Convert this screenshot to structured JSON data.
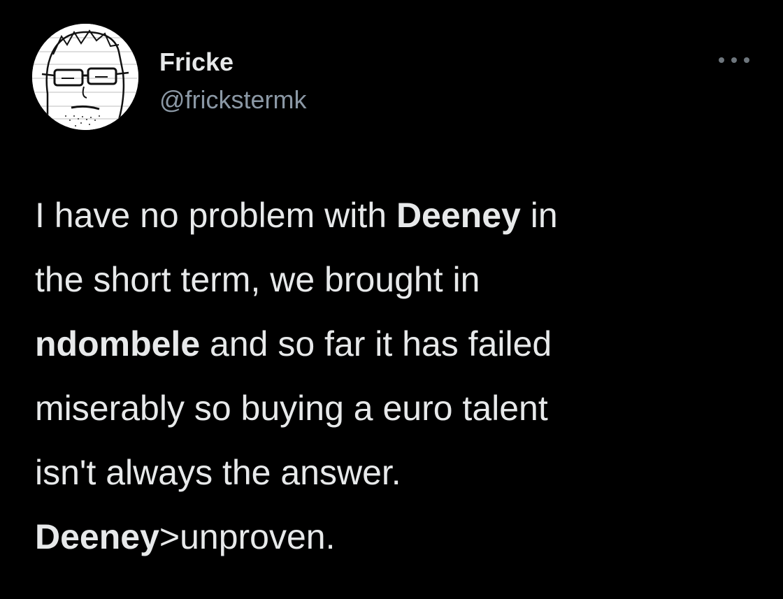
{
  "author": {
    "display_name": "Fricke",
    "handle": "@frickstermk",
    "avatar_icon": "cartoon-face-avatar"
  },
  "more_icon": "more-options-icon",
  "tweet": {
    "lines": [
      [
        {
          "text": "I have no problem with ",
          "bold": false
        },
        {
          "text": "Deeney",
          "bold": true
        },
        {
          "text": " in",
          "bold": false
        }
      ],
      [
        {
          "text": "the short term, we brought in",
          "bold": false
        }
      ],
      [
        {
          "text": "ndombele",
          "bold": true
        },
        {
          "text": " and so far it has failed",
          "bold": false
        }
      ],
      [
        {
          "text": "miserably so buying a euro talent",
          "bold": false
        }
      ],
      [
        {
          "text": "isn't always the answer.",
          "bold": false
        }
      ],
      [
        {
          "text": "Deeney",
          "bold": true
        },
        {
          "text": ">unproven.",
          "bold": false
        }
      ]
    ]
  },
  "colors": {
    "background": "#000000",
    "primary_text": "#e7e9ea",
    "secondary_text": "#8b98a5"
  }
}
